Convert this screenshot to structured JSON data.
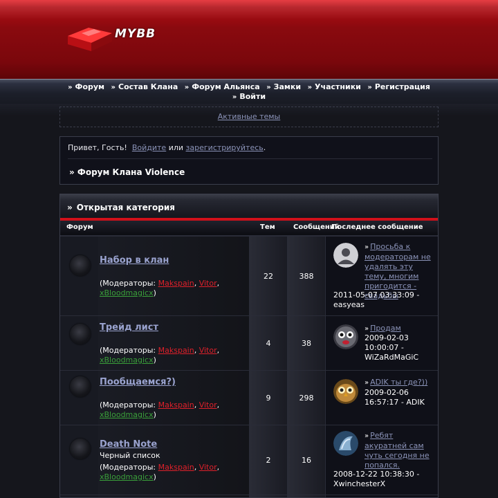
{
  "header": {
    "logo_text": "MYBB"
  },
  "nav": {
    "row1": [
      "Форум",
      "Состав Клана",
      "Форум Альянса",
      "Замки",
      "Участники",
      "Регистрация"
    ],
    "row2": [
      "Войти"
    ]
  },
  "active_topics": "Активные темы",
  "welcome": {
    "greeting": "Привет, Гость!",
    "login": "Войдите",
    "or": "или",
    "register": "зарегистрируйтесь",
    "dot": ".",
    "breadcrumb": "» Форум Клана Violence"
  },
  "category": {
    "title": "Открытая категория",
    "col_forum": "Форум",
    "col_topics": "Тем",
    "col_posts": "Сообщений",
    "col_last": "Последнее сообщение"
  },
  "mods_prefix": "(Модераторы: ",
  "mods": [
    "Makspain",
    "Vitor",
    "xBloodmagicx"
  ],
  "forums": [
    {
      "title": "Набор в клан",
      "desc": "",
      "topics": "22",
      "posts": "388",
      "last_title": "Просьба к модераторам не удалять эту тему, многим пригодится - свадьбы",
      "last_meta": "2011-05-07 03:33:09 - easyeas"
    },
    {
      "title": "Трейд лист",
      "desc": "",
      "topics": "4",
      "posts": "38",
      "last_title": "Продам",
      "last_meta": "2009-02-03 10:00:07 - WiZaRdMaGiC"
    },
    {
      "title": "Пообщаемся?)",
      "desc": "",
      "topics": "9",
      "posts": "298",
      "last_title": "ADIK ты где?))",
      "last_meta": "2009-02-06 16:57:17 - ADIK"
    },
    {
      "title": "Death Note",
      "desc": "Черный список",
      "topics": "2",
      "posts": "16",
      "last_title": "Ребят акуратней сам чуть сегодня не попался.",
      "last_meta": "2008-12-22 10:38:30 - XwinchesterX"
    }
  ]
}
